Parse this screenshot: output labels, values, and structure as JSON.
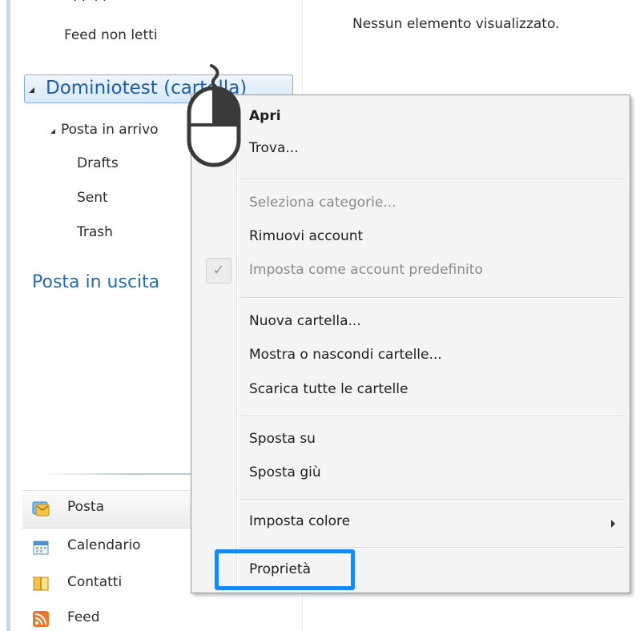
{
  "sidebar": {
    "cut_top_text": "...",
    "unread_feeds": "Feed non letti",
    "account": "Dominiotest (cartella)",
    "folders": [
      {
        "label": "Posta in arrivo"
      },
      {
        "label": "Drafts"
      },
      {
        "label": "Sent"
      },
      {
        "label": "Trash"
      }
    ],
    "outbox": "Posta in uscita",
    "nav": [
      {
        "label": "Posta",
        "icon": "mail-icon"
      },
      {
        "label": "Calendario",
        "icon": "calendar-icon"
      },
      {
        "label": "Contatti",
        "icon": "contacts-icon"
      },
      {
        "label": "Feed",
        "icon": "feed-icon"
      }
    ]
  },
  "main": {
    "empty_message": "Nessun elemento visualizzato."
  },
  "context_menu": {
    "items": [
      {
        "label": "Apri"
      },
      {
        "label": "Trova..."
      },
      {
        "label": "Seleziona categorie..."
      },
      {
        "label": "Rimuovi account"
      },
      {
        "label": "Imposta come account predefinito"
      },
      {
        "label": "Nuova cartella..."
      },
      {
        "label": "Mostra o nascondi cartelle..."
      },
      {
        "label": "Scarica tutte le cartelle"
      },
      {
        "label": "Sposta su"
      },
      {
        "label": "Sposta giù"
      },
      {
        "label": "Imposta colore"
      },
      {
        "label": "Proprietà"
      }
    ],
    "check_glyph": "✓"
  },
  "colors": {
    "account_text": "#1f5ea8",
    "highlight": "#1b87f5",
    "menu_bg": "#f4f4f4",
    "disabled_text": "#8a8a8a"
  }
}
